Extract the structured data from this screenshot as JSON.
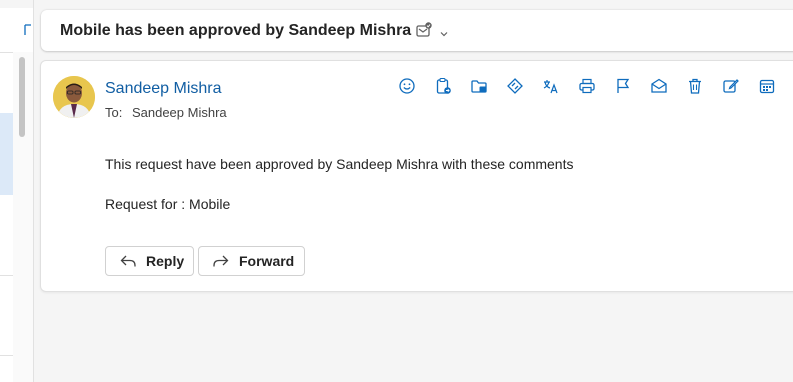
{
  "subject": {
    "title": "Mobile has been approved by Sandeep Mishra"
  },
  "message": {
    "sender_name": "Sandeep Mishra",
    "to_label": "To:",
    "to_name": "Sandeep Mishra",
    "body_line1": "This request have been approved by Sandeep Mishra with these comments",
    "body_line2": "Request for : Mobile"
  },
  "toolbar": {
    "icons": [
      "emoji-icon",
      "clipboard-icon",
      "move-folder-icon",
      "tag-icon",
      "translate-icon",
      "print-icon",
      "flag-icon",
      "mark-read-icon",
      "delete-icon",
      "edit-icon",
      "calendar-icon"
    ]
  },
  "actions": {
    "reply_label": "Reply",
    "forward_label": "Forward"
  },
  "colors": {
    "accent": "#115ea3",
    "icon": "#0f6cbd"
  }
}
